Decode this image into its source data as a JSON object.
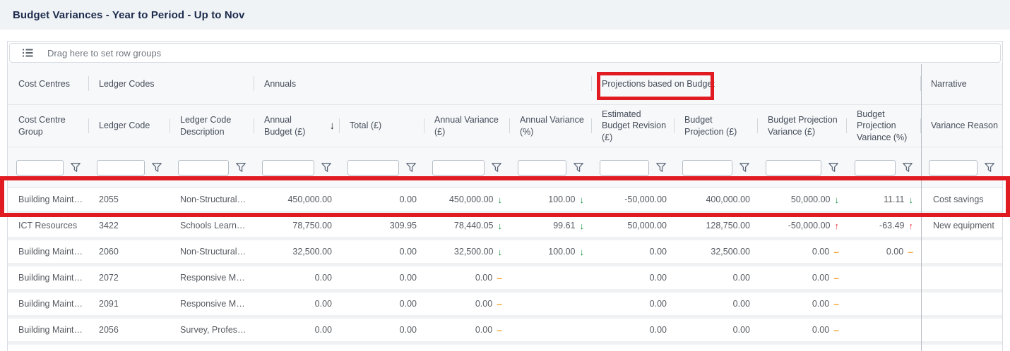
{
  "title": "Budget Variances - Year to Period - Up to Nov",
  "row_group_panel": {
    "hint": "Drag here to set row groups"
  },
  "header": {
    "groups": [
      {
        "label": "Cost Centres",
        "span": 1,
        "highlighted": false
      },
      {
        "label": "Ledger Codes",
        "span": 2,
        "highlighted": false
      },
      {
        "label": "Annuals",
        "span": 4,
        "highlighted": false
      },
      {
        "label": "Projections based on Budget",
        "span": 4,
        "highlighted": true
      },
      {
        "label": "Narrative",
        "span": 1,
        "highlighted": false
      }
    ],
    "columns": [
      {
        "label": "Cost Centre Group",
        "align": "left"
      },
      {
        "label": "Ledger Code",
        "align": "left"
      },
      {
        "label": "Ledger Code Description",
        "align": "left"
      },
      {
        "label": "Annual Budget (£)",
        "align": "right",
        "sort": "desc"
      },
      {
        "label": "Total (£)",
        "align": "right"
      },
      {
        "label": "Annual Variance (£)",
        "align": "right"
      },
      {
        "label": "Annual Variance (%)",
        "align": "right"
      },
      {
        "label": "Estimated Budget Revision (£)",
        "align": "right"
      },
      {
        "label": "Budget Projection (£)",
        "align": "right"
      },
      {
        "label": "Budget Projection Variance (£)",
        "align": "right"
      },
      {
        "label": "Budget Projection Variance (%)",
        "align": "right"
      },
      {
        "label": "Variance Reason",
        "align": "left",
        "pinned": "right"
      }
    ]
  },
  "filter_row": {
    "value": "",
    "placeholder": ""
  },
  "rows": [
    {
      "highlighted": true,
      "cells": [
        "Building Maint…",
        "2055",
        "Non-Structural…",
        "450,000.00",
        "0.00",
        {
          "t": "450,000.00",
          "i": "down-green"
        },
        {
          "t": "100.00",
          "i": "down-green"
        },
        "-50,000.00",
        "400,000.00",
        {
          "t": "50,000.00",
          "i": "down-green"
        },
        {
          "t": "11.11",
          "i": "down-green"
        },
        "Cost savings"
      ]
    },
    {
      "highlighted": false,
      "cells": [
        "ICT Resources",
        "3422",
        "Schools Learn…",
        "78,750.00",
        "309.95",
        {
          "t": "78,440.05",
          "i": "down-green"
        },
        {
          "t": "99.61",
          "i": "down-green"
        },
        "50,000.00",
        "128,750.00",
        {
          "t": "-50,000.00",
          "i": "up-red"
        },
        {
          "t": "-63.49",
          "i": "up-red"
        },
        "New equipment"
      ]
    },
    {
      "highlighted": false,
      "cells": [
        "Building Maint…",
        "2060",
        "Non-Structural…",
        "32,500.00",
        "0.00",
        {
          "t": "32,500.00",
          "i": "down-green"
        },
        {
          "t": "100.00",
          "i": "down-green"
        },
        "0.00",
        "32,500.00",
        {
          "t": "0.00",
          "i": "dash-amber"
        },
        {
          "t": "0.00",
          "i": "dash-amber"
        },
        ""
      ]
    },
    {
      "highlighted": false,
      "cells": [
        "Building Maint…",
        "2072",
        "Responsive M…",
        "0.00",
        "0.00",
        {
          "t": "0.00",
          "i": "dash-amber"
        },
        "",
        "0.00",
        "0.00",
        {
          "t": "0.00",
          "i": "dash-amber"
        },
        "",
        ""
      ]
    },
    {
      "highlighted": false,
      "cells": [
        "Building Maint…",
        "2091",
        "Responsive M…",
        "0.00",
        "0.00",
        {
          "t": "0.00",
          "i": "dash-amber"
        },
        "",
        "0.00",
        "0.00",
        {
          "t": "0.00",
          "i": "dash-amber"
        },
        "",
        ""
      ]
    },
    {
      "highlighted": false,
      "cells": [
        "Building Maint…",
        "2056",
        "Survey, Profes…",
        "0.00",
        "0.00",
        {
          "t": "0.00",
          "i": "dash-amber"
        },
        "",
        "0.00",
        "0.00",
        {
          "t": "0.00",
          "i": "dash-amber"
        },
        "",
        ""
      ]
    }
  ],
  "indicators": {
    "down-green": "↓",
    "up-red": "↑",
    "dash-amber": "–"
  },
  "icons": {
    "sort_desc": "↓",
    "filter": "funnel-icon",
    "row_group": "row-group-icon"
  },
  "colors": {
    "annotation_red": "#e11b22",
    "positive_green": "#13913e",
    "negative_red": "#e5333f",
    "neutral_amber": "#f2a432",
    "title_text": "#1d2c4d",
    "header_bg": "#f7f8fa",
    "titlebar_bg": "#f0f3f6"
  }
}
